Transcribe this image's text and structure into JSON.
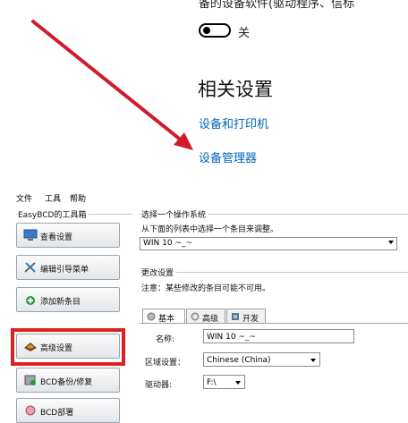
{
  "settings": {
    "cut_text": "备的设备软件(驱动程序、信标",
    "toggle_state_label": "关",
    "related_title": "相关设置",
    "links": [
      "设备和打印机",
      "设备管理器"
    ]
  },
  "colors": {
    "link": "#0067b8",
    "arrow": "#d11a2a",
    "highlight": "#e02020"
  },
  "easybcd": {
    "menu": [
      "文件",
      "工具",
      "帮助"
    ],
    "toolbox_label": "EasyBCD的工具箱",
    "nav": [
      {
        "label": "查看设置",
        "icon": "monitor-icon"
      },
      {
        "label": "编辑引导菜单",
        "icon": "tools-icon"
      },
      {
        "label": "添加新条目",
        "icon": "add-entry-icon"
      },
      {
        "label": "高级设置",
        "icon": "advanced-icon"
      },
      {
        "label": "BCD备份/修复",
        "icon": "backup-icon"
      },
      {
        "label": "BCD部署",
        "icon": "deploy-icon"
      }
    ],
    "highlighted_item": "高级设置",
    "os_section": {
      "title": "选择一个操作系统",
      "hint": "从下面的列表中选择一个条目来调整。",
      "selected": "WIN 10 ~_~"
    },
    "change_section": {
      "title": "更改设置",
      "note": "注意：某些修改的条目可能不可用。",
      "tabs": [
        {
          "label": "基本",
          "icon": "basic-icon"
        },
        {
          "label": "高级",
          "icon": "gear-icon"
        },
        {
          "label": "开发",
          "icon": "dev-icon"
        }
      ],
      "name_label": "名称:",
      "name_value": "WIN 10 ~_~",
      "locale_label": "区域设置：",
      "locale_value": "Chinese (China)",
      "drive_label": "驱动器:",
      "drive_value": "F:\\"
    }
  }
}
